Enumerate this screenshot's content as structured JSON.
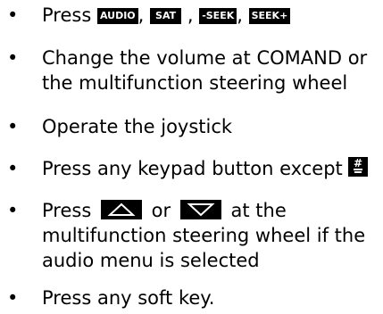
{
  "items": [
    {
      "press": "Press",
      "keys": [
        "AUDIO",
        "SAT",
        "-SEEK",
        "SEEK+"
      ],
      "sep": ","
    },
    {
      "line1": "Change the volume at COMAND or",
      "line2": "the multifunction steering wheel"
    },
    {
      "line1": "Operate the joystick"
    },
    {
      "line1": "Press any keypad button except",
      "key_icon": "hash-key-icon"
    },
    {
      "press": "Press",
      "or": "or",
      "tail": "at the",
      "line2": "multifunction steering wheel if the",
      "line3": "audio menu is selected",
      "icons": [
        "up-arrow-key-icon",
        "down-arrow-key-icon"
      ]
    },
    {
      "line1": "Press any soft key."
    }
  ],
  "colors": {
    "text": "#000000",
    "key_bg": "#000000",
    "key_fg": "#ffffff"
  }
}
